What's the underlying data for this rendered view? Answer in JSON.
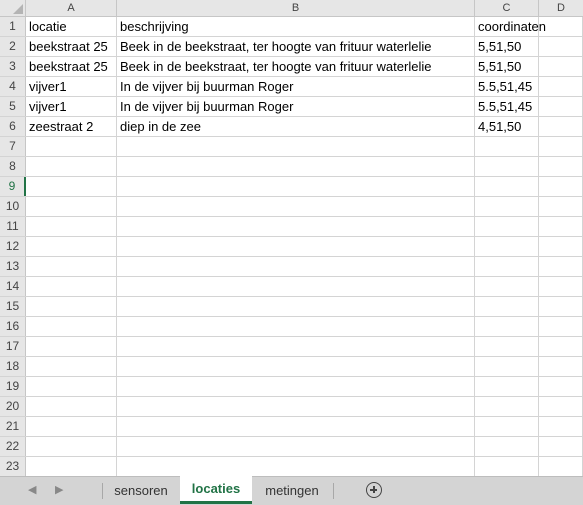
{
  "columns": [
    "A",
    "B",
    "C",
    "D"
  ],
  "rows": [
    {
      "num": "1",
      "a": "locatie",
      "b": "beschrijving",
      "c": "coordinaten"
    },
    {
      "num": "2",
      "a": "beekstraat 25",
      "b": "Beek in de beekstraat, ter hoogte van frituur waterlelie",
      "c": "5,51,50"
    },
    {
      "num": "3",
      "a": "beekstraat 25",
      "b": "Beek in de beekstraat, ter hoogte van frituur waterlelie",
      "c": "5,51,50"
    },
    {
      "num": "4",
      "a": "vijver1",
      "b": "In de vijver bij buurman Roger",
      "c": "5.5,51,45"
    },
    {
      "num": "5",
      "a": "vijver1",
      "b": "In de vijver bij buurman Roger",
      "c": "5.5,51,45"
    },
    {
      "num": "6",
      "a": "zeestraat 2",
      "b": "diep in de zee",
      "c": "4,51,50"
    },
    {
      "num": "7",
      "a": "",
      "b": "",
      "c": ""
    },
    {
      "num": "8",
      "a": "",
      "b": "",
      "c": ""
    },
    {
      "num": "9",
      "a": "",
      "b": "",
      "c": ""
    },
    {
      "num": "10",
      "a": "",
      "b": "",
      "c": ""
    },
    {
      "num": "11",
      "a": "",
      "b": "",
      "c": ""
    },
    {
      "num": "12",
      "a": "",
      "b": "",
      "c": ""
    },
    {
      "num": "13",
      "a": "",
      "b": "",
      "c": ""
    },
    {
      "num": "14",
      "a": "",
      "b": "",
      "c": ""
    },
    {
      "num": "15",
      "a": "",
      "b": "",
      "c": ""
    },
    {
      "num": "16",
      "a": "",
      "b": "",
      "c": ""
    },
    {
      "num": "17",
      "a": "",
      "b": "",
      "c": ""
    },
    {
      "num": "18",
      "a": "",
      "b": "",
      "c": ""
    },
    {
      "num": "19",
      "a": "",
      "b": "",
      "c": ""
    },
    {
      "num": "20",
      "a": "",
      "b": "",
      "c": ""
    },
    {
      "num": "21",
      "a": "",
      "b": "",
      "c": ""
    },
    {
      "num": "22",
      "a": "",
      "b": "",
      "c": ""
    },
    {
      "num": "23",
      "a": "",
      "b": "",
      "c": ""
    }
  ],
  "selected_row": "9",
  "tabs": [
    {
      "label": "sensoren",
      "active": false
    },
    {
      "label": "locaties",
      "active": true
    },
    {
      "label": "metingen",
      "active": false
    }
  ],
  "nav": {
    "prev_icon": "chevron-left-icon",
    "next_icon": "chevron-right-icon",
    "prev_glyph": "◀",
    "next_glyph": "▶"
  },
  "add_sheet_icon": "plus-circle-icon",
  "accent_color": "#217346"
}
